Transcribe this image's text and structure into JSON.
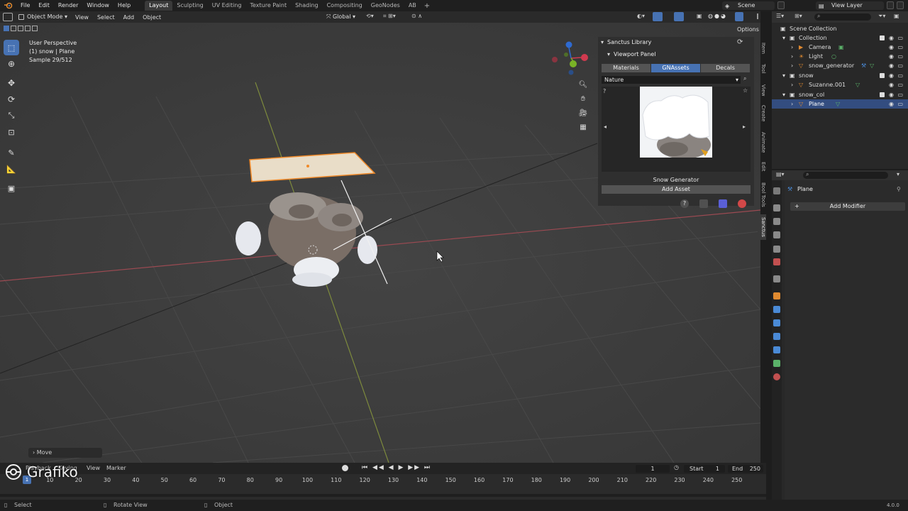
{
  "topbar": {
    "menus": [
      "File",
      "Edit",
      "Render",
      "Window",
      "Help"
    ],
    "workspaces": [
      "Layout",
      "Sculpting",
      "UV Editing",
      "Texture Paint",
      "Shading",
      "Compositing",
      "GeoNodes",
      "AB"
    ],
    "active_workspace": "Layout",
    "scene": "Scene",
    "view_layer": "View Layer"
  },
  "viewport": {
    "mode": "Object Mode",
    "menus": [
      "View",
      "Select",
      "Add",
      "Object"
    ],
    "orientation": "Global",
    "options": "Options",
    "overlay_lines": [
      "User Perspective",
      "(1) snow | Plane",
      "Sample 29/512"
    ],
    "last_operator": "Move"
  },
  "sanctus": {
    "title": "Sanctus Library",
    "subtitle": "Viewport Panel",
    "tabs": [
      "Materials",
      "GNAssets",
      "Decals"
    ],
    "active_tab": "GNAssets",
    "category": "Nature",
    "asset_name": "Snow Generator",
    "add_button": "Add Asset"
  },
  "side_tabs": [
    "Item",
    "Tool",
    "View",
    "Create",
    "Animate",
    "Edit",
    "Bool Tools",
    "Sanctus"
  ],
  "outliner": {
    "root": "Scene Collection",
    "rows": [
      {
        "label": "Collection",
        "indent": 1
      },
      {
        "label": "Camera",
        "indent": 2
      },
      {
        "label": "Light",
        "indent": 2
      },
      {
        "label": "snow_generator",
        "indent": 2
      },
      {
        "label": "snow",
        "indent": 1
      },
      {
        "label": "Suzanne.001",
        "indent": 2
      },
      {
        "label": "snow_col",
        "indent": 1
      },
      {
        "label": "Plane",
        "indent": 2,
        "selected": true
      }
    ]
  },
  "properties": {
    "object_name": "Plane",
    "add_modifier": "Add Modifier"
  },
  "timeline": {
    "menus": [
      "Playback",
      "Keying",
      "View",
      "Marker"
    ],
    "current_frame": "1",
    "start_label": "Start",
    "start_value": "1",
    "end_label": "End",
    "end_value": "250",
    "ticks": [
      "10",
      "20",
      "30",
      "40",
      "50",
      "60",
      "70",
      "80",
      "90",
      "100",
      "110",
      "120",
      "130",
      "140",
      "150",
      "160",
      "170",
      "180",
      "190",
      "200",
      "210",
      "220",
      "230",
      "240",
      "250"
    ],
    "playhead_label": "1"
  },
  "statusbar": {
    "items": [
      "Select",
      "Rotate View",
      "Object"
    ],
    "version": "4.0.0"
  },
  "watermark": "Grafiko"
}
